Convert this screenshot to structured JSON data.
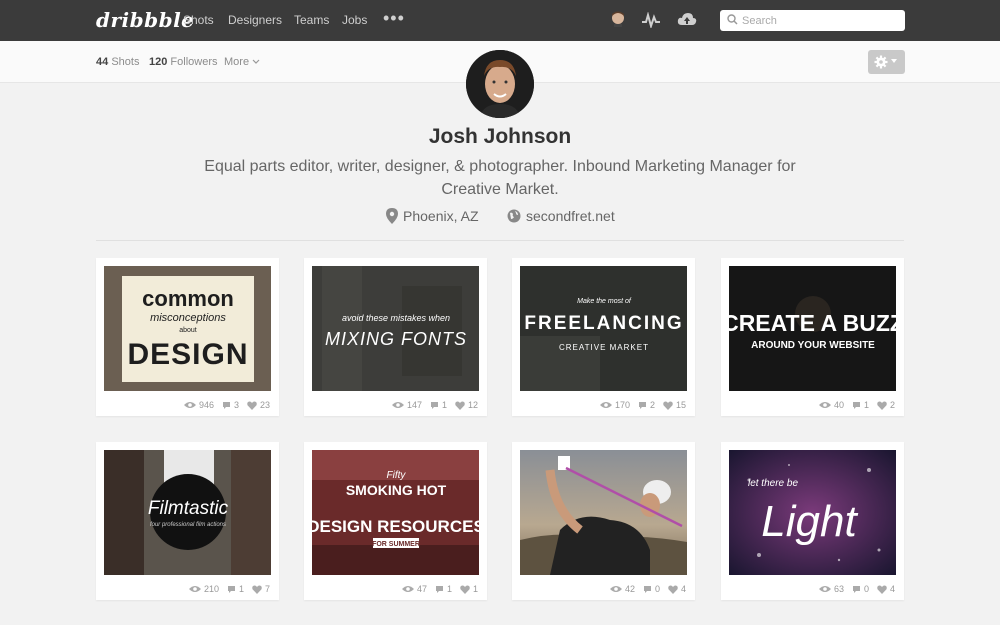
{
  "nav": {
    "logo": "dribbble",
    "links": [
      "Shots",
      "Designers",
      "Teams",
      "Jobs"
    ],
    "more_dots": "•••",
    "search_placeholder": "Search"
  },
  "subbar": {
    "shots_count": "44",
    "shots_label": "Shots",
    "followers_count": "120",
    "followers_label": "Followers",
    "more_label": "More"
  },
  "profile": {
    "name": "Josh Johnson",
    "bio": "Equal parts editor, writer, designer, & photographer. Inbound Marketing Manager for Creative Market.",
    "location": "Phoenix, AZ",
    "website": "secondfret.net"
  },
  "shots": [
    {
      "views": "946",
      "comments": "3",
      "likes": "23",
      "lines": [
        "common",
        "misconceptions",
        "about",
        "DESIGN"
      ]
    },
    {
      "views": "147",
      "comments": "1",
      "likes": "12",
      "lines": [
        "avoid these mistakes when",
        "MIXING FONTS"
      ]
    },
    {
      "views": "170",
      "comments": "2",
      "likes": "15",
      "lines": [
        "Make the most of",
        "FREELANCING",
        "CREATIVE MARKET"
      ]
    },
    {
      "views": "40",
      "comments": "1",
      "likes": "2",
      "lines": [
        "CREATE A BUZZ",
        "AROUND YOUR WEBSITE"
      ]
    },
    {
      "views": "210",
      "comments": "1",
      "likes": "7",
      "lines": [
        "Filmtastic",
        "four professional film actions"
      ]
    },
    {
      "views": "47",
      "comments": "1",
      "likes": "1",
      "lines": [
        "Fifty",
        "SMOKING HOT",
        "DESIGN RESOURCES",
        "FOR SUMMER"
      ]
    },
    {
      "views": "42",
      "comments": "0",
      "likes": "4",
      "lines": []
    },
    {
      "views": "63",
      "comments": "0",
      "likes": "4",
      "lines": [
        "let there be",
        "Light"
      ]
    }
  ]
}
